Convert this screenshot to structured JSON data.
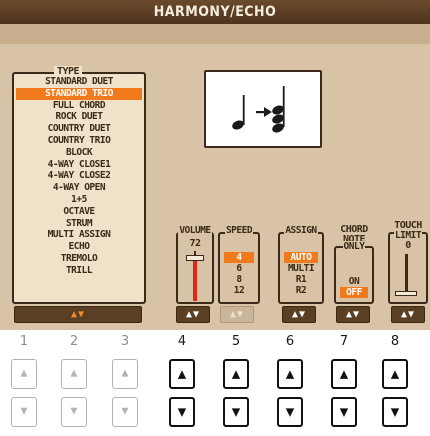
{
  "screen": {
    "title": "HARMONY/ECHO"
  },
  "type_panel": {
    "label": "TYPE",
    "items": [
      "STANDARD DUET",
      "STANDARD TRIO",
      "FULL CHORD",
      "ROCK DUET",
      "COUNTRY DUET",
      "COUNTRY TRIO",
      "BLOCK",
      "4-WAY CLOSE1",
      "4-WAY CLOSE2",
      "4-WAY OPEN",
      "1+5",
      "OCTAVE",
      "STRUM",
      "MULTI ASSIGN",
      "ECHO",
      "TREMOLO",
      "TRILL"
    ],
    "selected_index": 1,
    "scroll_arrows": "▲▼"
  },
  "volume": {
    "label": "VOLUME",
    "value": "72",
    "level": 0.72
  },
  "speed": {
    "label": "SPEED",
    "options": [
      "4",
      "6",
      "8",
      "12"
    ],
    "selected_index": 0
  },
  "assign": {
    "label": "ASSIGN",
    "options": [
      "AUTO",
      "MULTI",
      "R1",
      "R2"
    ],
    "selected_index": 0
  },
  "chord_note_only": {
    "label_line1": "CHORD",
    "label_line2": "NOTE",
    "label_line3": "ONLY",
    "options": [
      "ON",
      "OFF"
    ],
    "selected_index": 1
  },
  "touch_limit": {
    "label_line1": "TOUCH",
    "label_line2": "LIMIT",
    "value": "0",
    "level": 0.0
  },
  "tab_arrows": "▲▼",
  "soft_keys": {
    "columns": [
      "1",
      "2",
      "3",
      "4",
      "5",
      "6",
      "7",
      "8"
    ],
    "up_glyph": "▲",
    "down_glyph": "▼"
  },
  "colors": {
    "title_bar": "#5b3f24",
    "lcd_background": "#d8c3a6",
    "highlight": "#f07a1c",
    "text_dark": "#3b2a18"
  },
  "icons": {
    "preview": "quarter-note-arrow-chord-icon",
    "key_up": "triangle-up-icon",
    "key_down": "triangle-down-icon"
  }
}
